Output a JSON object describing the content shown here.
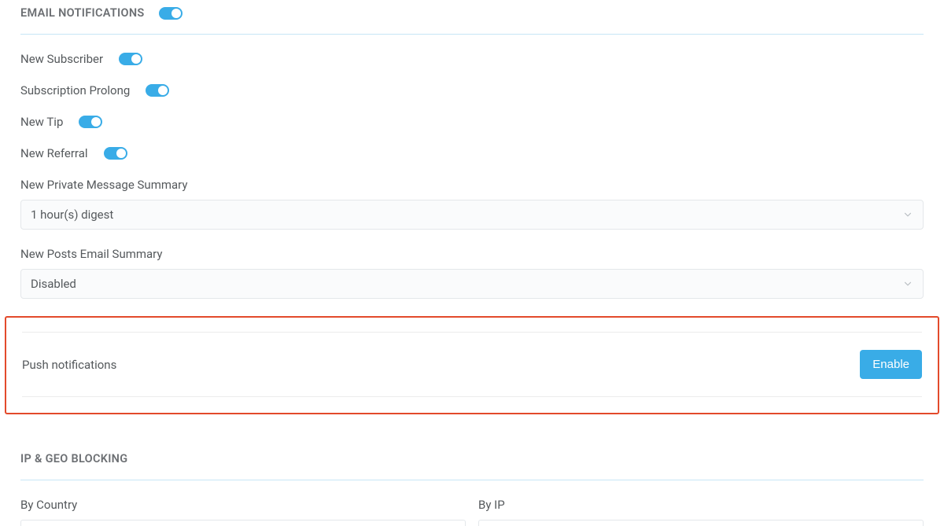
{
  "emailNotifications": {
    "title": "EMAIL NOTIFICATIONS",
    "toggles": {
      "newSubscriber": "New Subscriber",
      "subscriptionProlong": "Subscription Prolong",
      "newTip": "New Tip",
      "newReferral": "New Referral"
    },
    "privateMessageSummary": {
      "label": "New Private Message Summary",
      "value": "1 hour(s) digest"
    },
    "postsEmailSummary": {
      "label": "New Posts Email Summary",
      "value": "Disabled"
    }
  },
  "pushNotifications": {
    "label": "Push notifications",
    "button": "Enable"
  },
  "geoBlocking": {
    "title": "IP & GEO BLOCKING",
    "byCountry": "By Country",
    "byIp": "By IP"
  }
}
